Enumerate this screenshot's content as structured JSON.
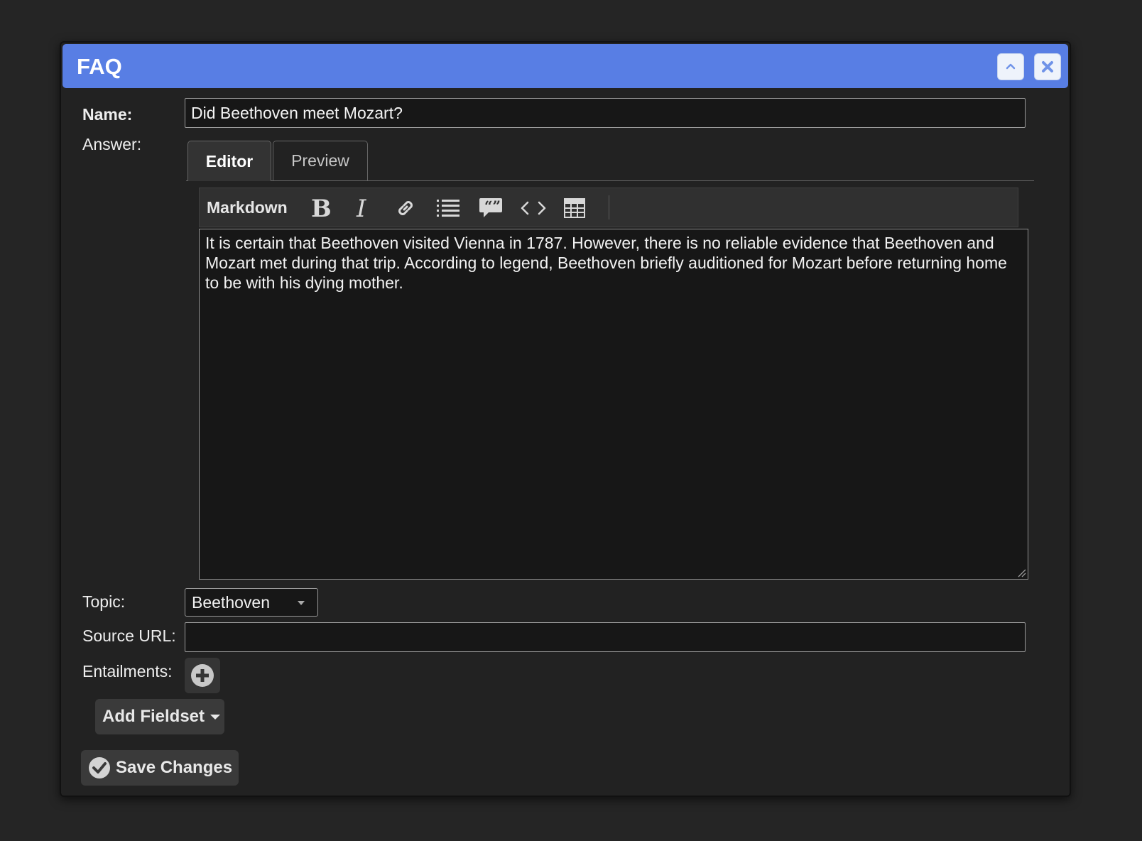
{
  "window": {
    "title": "FAQ",
    "collapse_icon": "chevron-up-icon",
    "close_icon": "close-icon"
  },
  "form": {
    "name_label": "Name:",
    "name_value": "Did Beethoven meet Mozart?",
    "answer_label": "Answer:",
    "tabs": [
      {
        "label": "Editor",
        "active": true
      },
      {
        "label": "Preview",
        "active": false
      }
    ],
    "toolbar": {
      "mode_label": "Markdown",
      "tools": [
        "bold-icon",
        "italic-icon",
        "link-icon",
        "list-icon",
        "quote-icon",
        "code-icon",
        "table-icon"
      ]
    },
    "answer_text": "It is certain that Beethoven visited Vienna in 1787. However, there is no reliable evidence that Beethoven and Mozart met during that trip. According to legend, Beethoven briefly auditioned for Mozart before returning home to be with his dying mother.",
    "topic_label": "Topic:",
    "topic_value": "Beethoven",
    "source_url_label": "Source URL:",
    "source_url_value": "",
    "entailments_label": "Entailments:",
    "add_fieldset_label": "Add Fieldset",
    "save_label": "Save Changes"
  },
  "colors": {
    "titlebar": "#587ee4",
    "background": "#222222",
    "input_background": "#171717"
  }
}
